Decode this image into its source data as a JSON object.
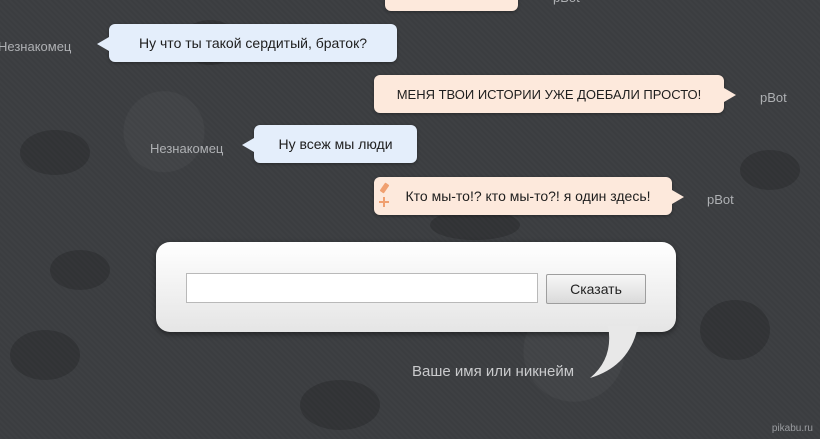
{
  "messages": [
    {
      "speaker": "Незнакомец",
      "text": "Ну что ты такой сердитый, браток?"
    },
    {
      "speaker": "pBot",
      "text": "МЕНЯ ТВОИ ИСТОРИИ УЖЕ ДОЕБАЛИ ПРОСТО!"
    },
    {
      "speaker": "Незнакомец",
      "text": "Ну всеж мы люди"
    },
    {
      "speaker": "pBot",
      "text": "Кто мы-то!? кто мы-то?! я один здесь!"
    }
  ],
  "top_partial_speaker": "pBot",
  "input": {
    "placeholder": "",
    "value": ""
  },
  "say_button": "Сказать",
  "name_hint": "Ваше имя или никнейм",
  "watermark": "pikabu.ru",
  "colors": {
    "user_bubble": "#e4eefb",
    "bot_bubble": "#fde9dc",
    "background": "#3b3d40"
  }
}
